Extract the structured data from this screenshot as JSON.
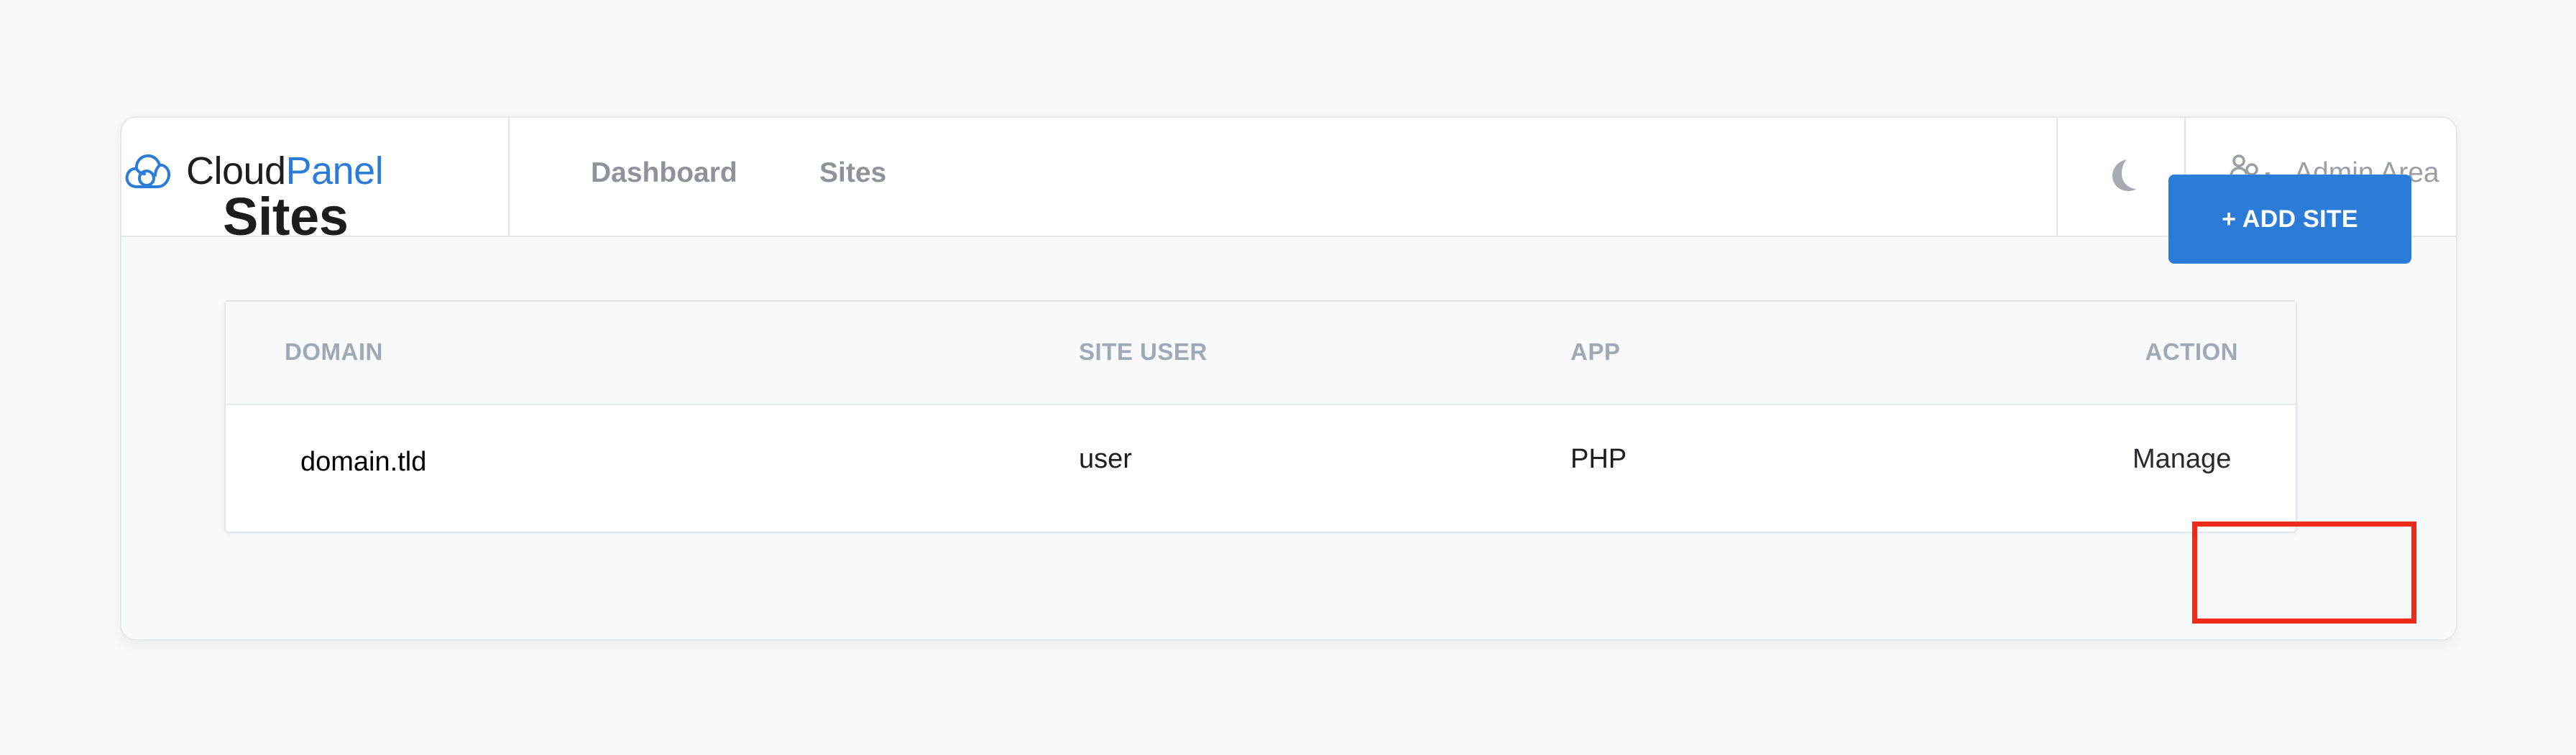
{
  "brand": {
    "name_part1": "Cloud",
    "name_part2": "Panel",
    "icon": "cloud-icon"
  },
  "nav": {
    "items": [
      {
        "label": "Dashboard"
      },
      {
        "label": "Sites"
      }
    ]
  },
  "header": {
    "theme_icon": "moon-icon",
    "admin_icon": "users-gear-icon",
    "admin_label": "Admin Area"
  },
  "page": {
    "title": "Sites",
    "add_button_label": "+ ADD SITE"
  },
  "table": {
    "columns": [
      "DOMAIN",
      "SITE USER",
      "APP",
      "ACTION"
    ],
    "rows": [
      {
        "domain": "domain.tld",
        "site_user": "user",
        "app": "PHP",
        "action": "Manage"
      }
    ]
  },
  "colors": {
    "accent": "#2b7bd8",
    "highlight": "#ee2b1a",
    "background": "#f8f8f9"
  }
}
